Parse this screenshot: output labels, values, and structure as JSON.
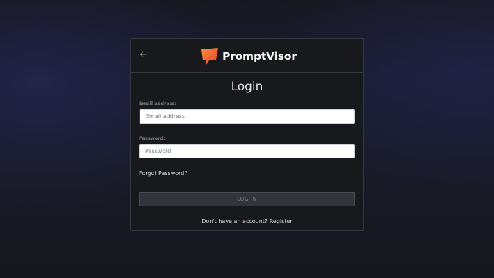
{
  "header": {
    "back_icon": "arrow-left-icon",
    "logo_icon": "speech-bubble-logo-icon",
    "logo_text": "PromptVisor",
    "brand_color": "#f26b3a"
  },
  "form": {
    "title": "Login",
    "email": {
      "label": "Email address:",
      "placeholder": "Email address",
      "value": ""
    },
    "password": {
      "label": "Password:",
      "placeholder": "Password",
      "value": ""
    },
    "forgot_label": "Forgot Password?",
    "submit_label": "LOG IN",
    "register_prompt": "Don't have an account?",
    "register_link": "Register"
  }
}
